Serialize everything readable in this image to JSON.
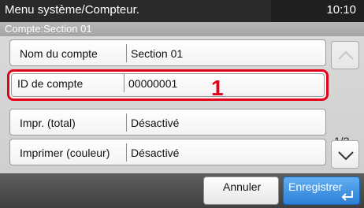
{
  "header": {
    "title": "Menu système/Compteur.",
    "clock": "10:10"
  },
  "subheader": {
    "title": "Compte:Section 01"
  },
  "rows": [
    {
      "label": "Nom du compte",
      "value": "Section 01"
    },
    {
      "label": "ID de compte",
      "value": "00000001"
    },
    {
      "label": "Impr. (total)",
      "value": "Désactivé"
    },
    {
      "label": "Imprimer (couleur)",
      "value": "Désactivé"
    }
  ],
  "callout": "1",
  "scroll": {
    "page": "1/2",
    "up_icon": "chevron-up-icon",
    "down_icon": "chevron-down-icon"
  },
  "footer": {
    "cancel_label": "Annuler",
    "save_label": "Enregistrer",
    "enter_icon": "enter-return-icon"
  },
  "colors": {
    "highlight": "#e4001b",
    "primary_button": "#2b7fd6",
    "titlebar": "#1f1f1f"
  }
}
